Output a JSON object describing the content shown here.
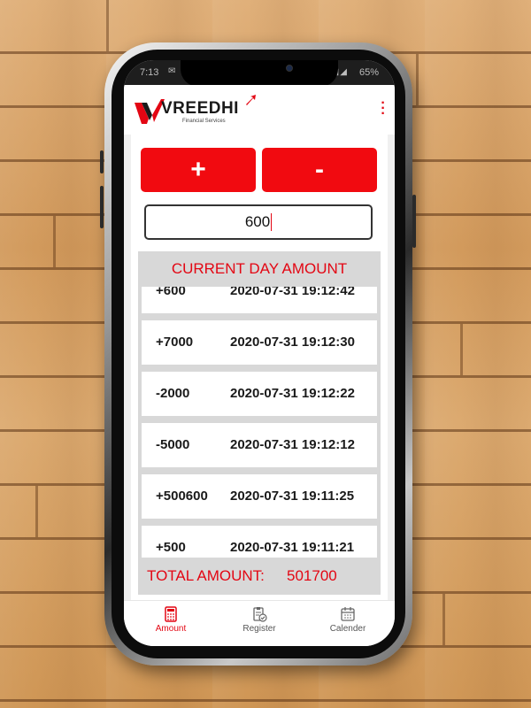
{
  "status_bar": {
    "time": "7:13",
    "battery": "65%"
  },
  "app_bar": {
    "logo_text": "VREEDHI",
    "logo_subtitle": "Financial Services",
    "brand_color": "#e30613"
  },
  "controls": {
    "plus_label": "+",
    "minus_label": "-",
    "amount_value": "600",
    "button_color": "#f10a10"
  },
  "history": {
    "title": "CURRENT DAY AMOUNT",
    "rows": [
      {
        "amount": "+600",
        "time": "2020-07-31 19:12:42"
      },
      {
        "amount": "+7000",
        "time": "2020-07-31 19:12:30"
      },
      {
        "amount": "-2000",
        "time": "2020-07-31 19:12:22"
      },
      {
        "amount": "-5000",
        "time": "2020-07-31 19:12:12"
      },
      {
        "amount": "+500600",
        "time": "2020-07-31 19:11:25"
      },
      {
        "amount": "+500",
        "time": "2020-07-31 19:11:21"
      }
    ],
    "total_label": "TOTAL AMOUNT:",
    "total_value": "501700"
  },
  "bottom_nav": {
    "items": [
      {
        "label": "Amount",
        "icon": "calculator-icon",
        "active": true
      },
      {
        "label": "Register",
        "icon": "clipboard-check-icon",
        "active": false
      },
      {
        "label": "Calender",
        "icon": "calendar-icon",
        "active": false
      }
    ]
  }
}
